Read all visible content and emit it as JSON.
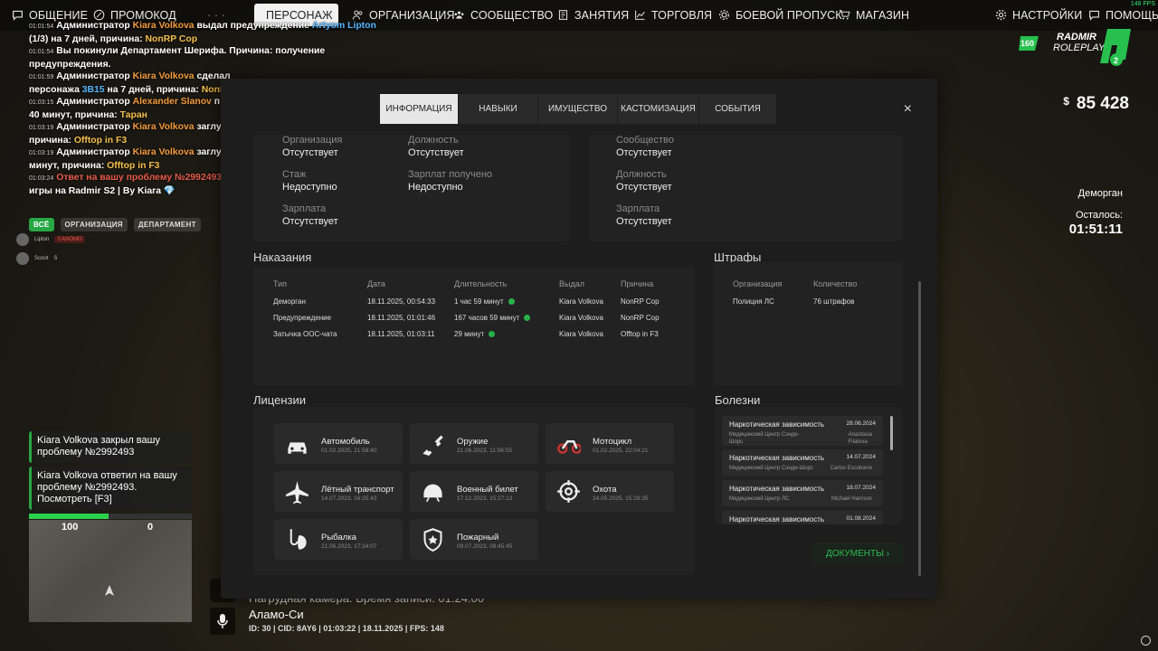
{
  "fps": "148 FPS",
  "nav": [
    {
      "label": "Общение",
      "icon": "chat-icon"
    },
    {
      "label": "Промокод",
      "icon": "percent-icon"
    },
    {
      "label": "· · ·",
      "icon": ""
    },
    {
      "label": "Персонаж",
      "icon": "user-icon"
    },
    {
      "label": "Организация",
      "icon": "people-icon"
    },
    {
      "label": "Сообщество",
      "icon": "group-icon"
    },
    {
      "label": "Занятия",
      "icon": "book-icon"
    },
    {
      "label": "Торговля",
      "icon": "chart-icon"
    },
    {
      "label": "Боевой пропуск",
      "icon": "gear-icon"
    },
    {
      "label": "Магазин",
      "icon": "cart-icon"
    },
    {
      "label": "Настройки",
      "icon": "settings-icon"
    },
    {
      "label": "Помощь",
      "icon": "help-icon"
    }
  ],
  "chat": [
    {
      "ts": "01:01:54",
      "parts": [
        [
          "Администратор ",
          ""
        ],
        [
          "Kiara Volkova",
          "o"
        ],
        [
          " выдал предупреждение ",
          ""
        ],
        [
          "Artyom Lipton",
          "b"
        ]
      ]
    },
    {
      "ts": "",
      "parts": [
        [
          "(1/3) на 7 дней, причина: ",
          ""
        ],
        [
          "NonRP Cop",
          "y"
        ]
      ]
    },
    {
      "ts": "01:01:54",
      "parts": [
        [
          "Вы покинули Департамент Шерифа. Причина: получение",
          ""
        ]
      ]
    },
    {
      "ts": "",
      "parts": [
        [
          "предупреждения.",
          ""
        ]
      ]
    },
    {
      "ts": "01:01:59",
      "parts": [
        [
          "Администратор ",
          ""
        ],
        [
          "Kiara Volkova",
          "o"
        ],
        [
          " сделал",
          ""
        ]
      ]
    },
    {
      "ts": "",
      "parts": [
        [
          "персонажа ",
          ""
        ],
        [
          "3B15",
          "b"
        ],
        [
          " на 7 дней, причина: ",
          ""
        ],
        [
          "NonR",
          "y"
        ]
      ]
    },
    {
      "ts": "01:03:15",
      "parts": [
        [
          "Администратор ",
          ""
        ],
        [
          "Alexander Slanov",
          "o"
        ],
        [
          " п",
          ""
        ]
      ]
    },
    {
      "ts": "",
      "parts": [
        [
          "40 минут, причина: ",
          ""
        ],
        [
          "Таран",
          "y"
        ]
      ]
    },
    {
      "ts": "01:03:19",
      "parts": [
        [
          "Администратор ",
          ""
        ],
        [
          "Kiara Volkova",
          "o"
        ],
        [
          " заглу",
          ""
        ]
      ]
    },
    {
      "ts": "",
      "parts": [
        [
          "причина: ",
          ""
        ],
        [
          "Offtop in F3",
          "y"
        ]
      ]
    },
    {
      "ts": "01:03:19",
      "parts": [
        [
          "Администратор ",
          ""
        ],
        [
          "Kiara Volkova",
          "o"
        ],
        [
          " заглу",
          ""
        ]
      ]
    },
    {
      "ts": "",
      "parts": [
        [
          "минут, причина: ",
          ""
        ],
        [
          "Offtop in F3",
          "y"
        ]
      ]
    },
    {
      "ts": "01:03:24",
      "parts": [
        [
          "Ответ на вашу проблему №2992493",
          "r"
        ]
      ]
    },
    {
      "ts": "",
      "parts": [
        [
          "игры на Radmir S2 | By Kiara ",
          ""
        ],
        [
          "💎",
          "b"
        ]
      ]
    }
  ],
  "chat_tabs": [
    "ВСЁ",
    "ОРГАНИЗАЦИЯ",
    "ДЕПАРТАМЕНТ"
  ],
  "voice": [
    {
      "name": "Lipton",
      "tag": "3 ANOMO"
    },
    {
      "name": "Scoot",
      "tag": "S"
    }
  ],
  "notifications": [
    "Kiara Volkova закрыл вашу проблему №2992493",
    "Kiara Volkova ответил на вашу проблему №2992493. Посмотреть [F3]"
  ],
  "hud": {
    "hp": "100",
    "armor": "0",
    "hp_fraction": 0.49,
    "money_symbol": "$",
    "money": "85 428",
    "event": "Деморган",
    "remain_label": "Осталось:",
    "remain_time": "01:51:11",
    "logo_top": "RADMIR",
    "logo_bottom": "ROLEPLAY",
    "logo_badge": "160",
    "logo_num": "2"
  },
  "bottom": {
    "line1": "Нагрудная камера. Время записи: 01:24:00",
    "line2": "Аламо-Си",
    "line3": "ID: 30 | CID: 8AY6 | 01:03:22  | 18.11.2025 | FPS: 148"
  },
  "modal": {
    "tabs": [
      "Информация",
      "Навыки",
      "Имущество",
      "Кастомизация",
      "События"
    ],
    "close": "×",
    "org": [
      [
        "Организация",
        "Отсутствует"
      ],
      [
        "Должность",
        "Отсутствует"
      ],
      [
        "Стаж",
        "Недоступно"
      ],
      [
        "Зарплат получено",
        "Недоступно"
      ],
      [
        "Зарплата",
        "Отсутствует"
      ]
    ],
    "comm": [
      [
        "Сообщество",
        "Отсутствует"
      ],
      [
        "Должность",
        "Отсутствует"
      ],
      [
        "Зарплата",
        "Отсутствует"
      ]
    ],
    "punish_title": "Наказания",
    "punish_cols": [
      "Тип",
      "Дата",
      "Длительность",
      "Выдал",
      "Причина"
    ],
    "punish_rows": [
      [
        "Деморган",
        "18.11.2025, 00:54:33",
        "1 час 59 минут",
        "Kiara Volkova",
        "NonRP Cop"
      ],
      [
        "Предупреждение",
        "18.11.2025, 01:01:46",
        "167 часов 59 минут",
        "Kiara Volkova",
        "NonRP Cop"
      ],
      [
        "Затычка ООС-чата",
        "18.11.2025, 01:03:11",
        "29 минут",
        "Kiara Volkova",
        "Offtop in F3"
      ]
    ],
    "fines_title": "Штрафы",
    "fines_cols": [
      "Организация",
      "Количество"
    ],
    "fines_rows": [
      [
        "Полиция ЛС",
        "76 штрафов"
      ]
    ],
    "lic_title": "Лицензии",
    "licenses": [
      {
        "name": "Автомобиль",
        "date": "01.02.2025, 21:58:40",
        "icon": "car-icon"
      },
      {
        "name": "Оружие",
        "date": "21.06.2023, 11:56:55",
        "icon": "rifle-icon"
      },
      {
        "name": "Мотоцикл",
        "date": "01.02.2025, 22:04:21",
        "icon": "motorcycle-icon"
      },
      {
        "name": "Лётный транспорт",
        "date": "14.07.2023, 16:35:43",
        "icon": "airplane-icon"
      },
      {
        "name": "Военный билет",
        "date": "17.12.2023, 15:27:13",
        "icon": "helmet-icon"
      },
      {
        "name": "Охота",
        "date": "24.05.2025, 15:28:35",
        "icon": "crosshair-icon"
      },
      {
        "name": "Рыбалка",
        "date": "21.06.2023, 17:34:07",
        "icon": "fish-icon"
      },
      {
        "name": "Пожарный",
        "date": "09.07.2023, 08:45:45",
        "icon": "shield-icon"
      }
    ],
    "dis_title": "Болезни",
    "diseases": [
      {
        "name": "Наркотическая зависимость",
        "date": "28.06.2024",
        "clinic": "Медицинский Центр Сэнди-\nШорс",
        "doc": "Anastasia\nFilatova"
      },
      {
        "name": "Наркотическая зависимость",
        "date": "14.07.2024",
        "clinic": "Медицинский Центр Сэнди-Шорс",
        "doc": "Carlos Escobarre"
      },
      {
        "name": "Наркотическая зависимость",
        "date": "18.07.2024",
        "clinic": "Медицинский Центр ЛС",
        "doc": "Michael Harrison"
      },
      {
        "name": "Наркотическая зависимость",
        "date": "01.08.2024",
        "clinic": "",
        "doc": ""
      }
    ],
    "docs_button": "ДОКУМЕНТЫ ›"
  }
}
